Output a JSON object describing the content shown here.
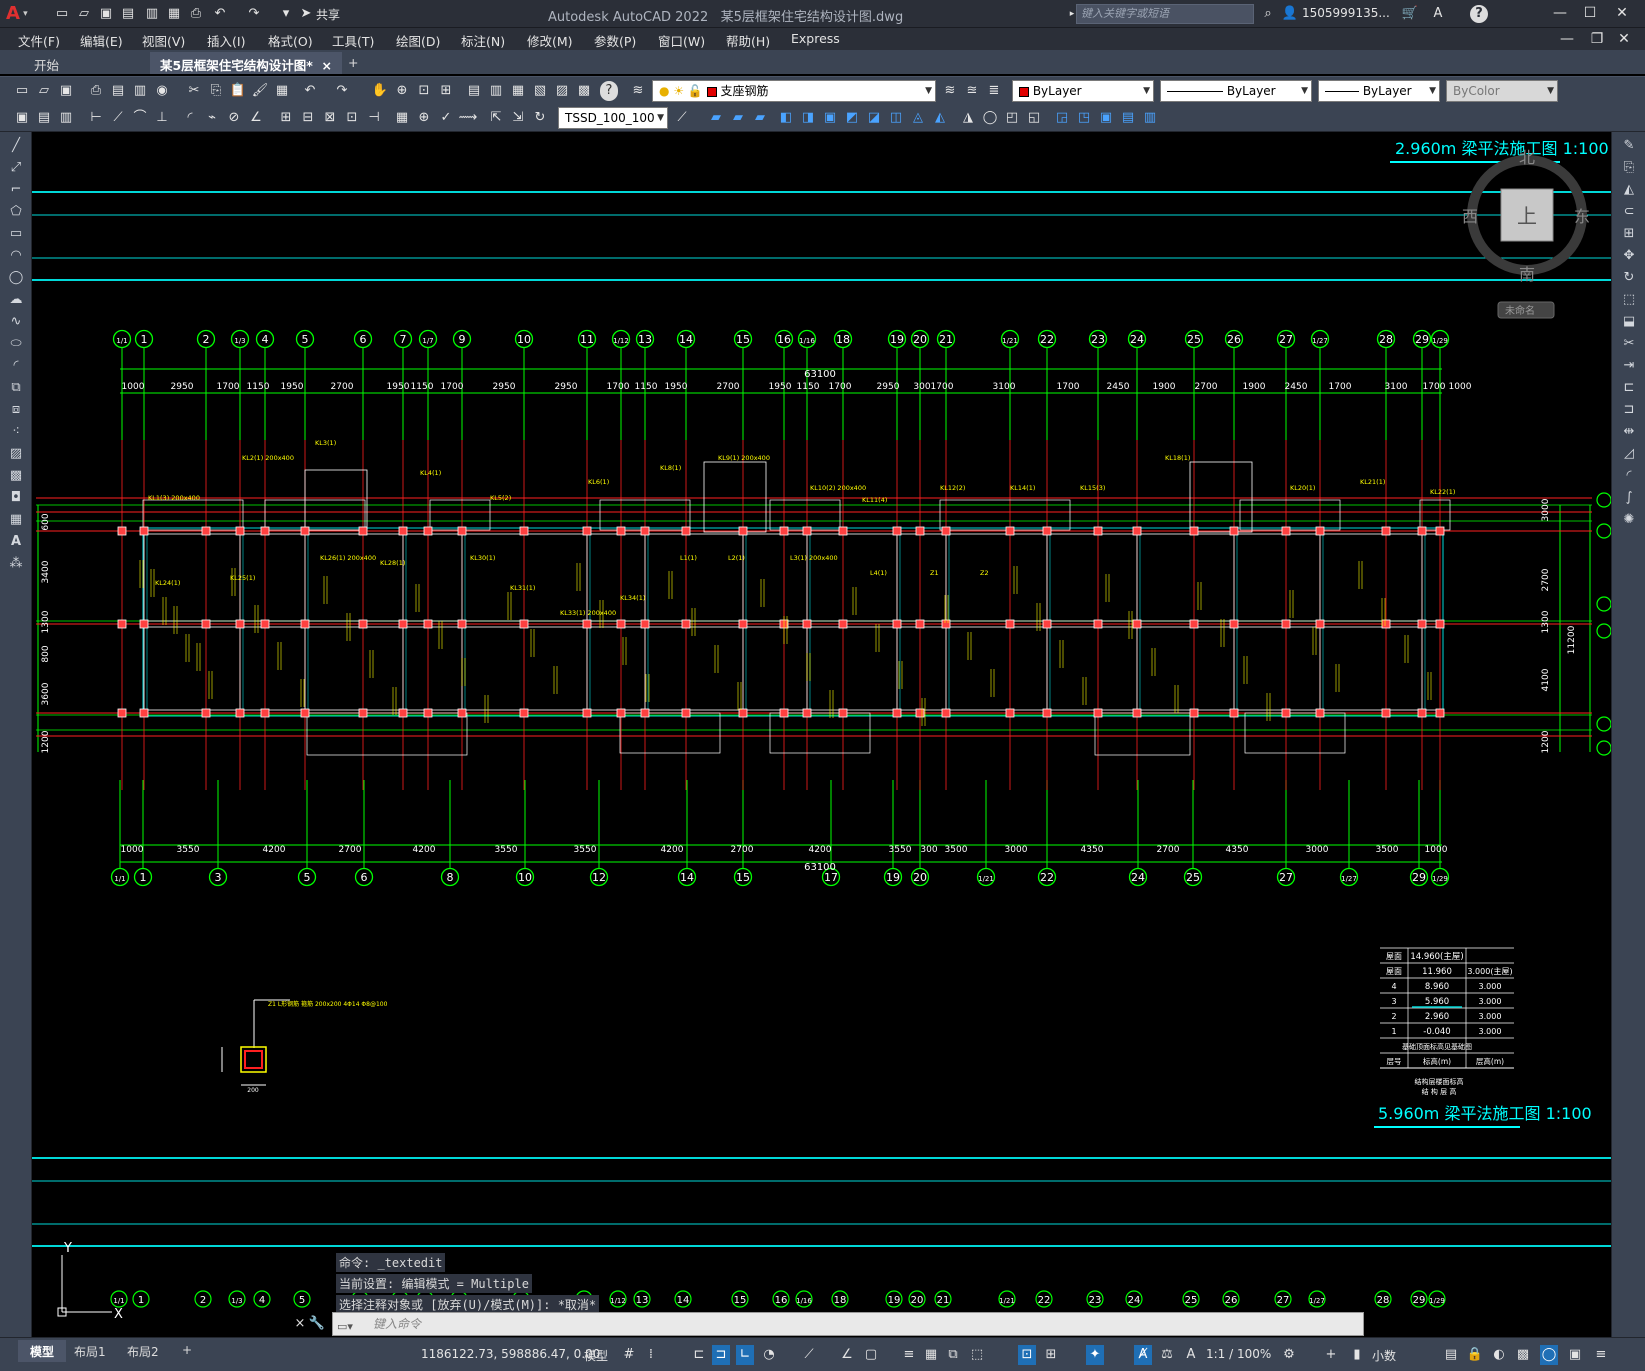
{
  "app": {
    "logo": "A",
    "title": "Autodesk AutoCAD 2022",
    "filename": "某5层框架住宅结构设计图.dwg",
    "share_label": "共享",
    "search_placeholder": "键入关键字或短语",
    "user": "1505999135...",
    "help": "?"
  },
  "menu": [
    "文件(F)",
    "编辑(E)",
    "视图(V)",
    "插入(I)",
    "格式(O)",
    "工具(T)",
    "绘图(D)",
    "标注(N)",
    "修改(M)",
    "参数(P)",
    "窗口(W)",
    "帮助(H)",
    "Express"
  ],
  "tabs": {
    "start": "开始",
    "doc": "某5层框架住宅结构设计图*",
    "close": "×",
    "add": "+"
  },
  "toolbar": {
    "layer": "支座钢筋",
    "color": "ByLayer",
    "linetype": "ByLayer",
    "lineweight": "ByLayer",
    "plotstyle": "ByColor",
    "textstyle": "TSSD_100_100"
  },
  "drawing": {
    "title_top": "2.960m 梁平法施工图 1:100",
    "title_bottom": "5.960m 梁平法施工图 1:100",
    "overall_dim": "63100",
    "viewcube": {
      "north": "北",
      "south": "南",
      "east": "东",
      "west": "西",
      "top": "上",
      "wcs": "未命名"
    },
    "top_axes": [
      "1/1",
      "1",
      "2",
      "1/3",
      "4",
      "5",
      "6",
      "7",
      "1/7",
      "9",
      "10",
      "11",
      "1/12",
      "13",
      "14",
      "15",
      "16",
      "1/16",
      "18",
      "19",
      "20",
      "21",
      "1/21",
      "22",
      "23",
      "24",
      "25",
      "26",
      "27",
      "1/27",
      "28",
      "29",
      "1/29"
    ],
    "bottom_axes": [
      "1/1",
      "1",
      "3",
      "5",
      "6",
      "8",
      "10",
      "12",
      "14",
      "15",
      "17",
      "19",
      "20",
      "1/21",
      "22",
      "24",
      "25",
      "27",
      "1/27",
      "29",
      "1/29"
    ],
    "top_dims": [
      "1000",
      "2950",
      "1700",
      "1150",
      "1950",
      "2700",
      "1950",
      "1150",
      "1700",
      "2950",
      "2950",
      "1700",
      "1150",
      "1950",
      "2700",
      "1950",
      "1150",
      "1700",
      "2950",
      "300",
      "1700",
      "3100",
      "1700",
      "2450",
      "1900",
      "2700",
      "1900",
      "2450",
      "1700",
      "3100",
      "1700",
      "1000"
    ],
    "bottom_dims": [
      "1000",
      "3550",
      "4200",
      "2700",
      "4200",
      "3550",
      "3550",
      "4200",
      "2700",
      "4200",
      "3550",
      "300",
      "3500",
      "3000",
      "4350",
      "2700",
      "4350",
      "3000",
      "3500",
      "1000"
    ],
    "left_dims": [
      "600",
      "3400",
      "1300",
      "800",
      "3600",
      "1200"
    ],
    "right_dims": [
      "3000",
      "2700",
      "1300",
      "4100",
      "1200",
      "11200"
    ],
    "beam_labels": [
      "KL1(3) 200x400",
      "KL2(1) 200x400",
      "KL3(1)",
      "KL4(1)",
      "KL5(2)",
      "KL6(1)",
      "KL8(1)",
      "KL9(1) 200x400",
      "KL10(2) 200x400",
      "KL11(4)",
      "KL12(2)",
      "KL14(1)",
      "KL15(3)",
      "KL18(1)",
      "KL20(1)",
      "KL21(1)",
      "KL22(1)",
      "KL24(1)",
      "KL25(1)",
      "KL26(1) 200x400",
      "KL28(1)",
      "KL30(1)",
      "KL31(1)",
      "KL33(1) 200x400",
      "KL34(1)",
      "L1(1)",
      "L2(1)",
      "L3(1) 200x400",
      "L4(1)",
      "Z1",
      "Z2"
    ],
    "table_rows": [
      {
        "floor": "屋面",
        "elev": "14.960(主屋)",
        "height": ""
      },
      {
        "floor": "屋面",
        "elev": "11.960",
        "height": "3.000(主屋)"
      },
      {
        "floor": "4",
        "elev": "8.960",
        "height": "3.000"
      },
      {
        "floor": "3",
        "elev": "5.960",
        "height": "3.000"
      },
      {
        "floor": "2",
        "elev": "2.960",
        "height": "3.000"
      },
      {
        "floor": "1",
        "elev": "-0.040",
        "height": "3.000"
      }
    ],
    "table_note": "基础顶面标高见基础图",
    "table_header": {
      "floor": "层号",
      "elev": "标高(m)",
      "height": "层高(m)"
    },
    "table_caption": "结构层楼面标高\n结 构 层 高",
    "detail_label": "Z1 L形钢筋 箍筋 200x200 4Φ14 Φ8@100",
    "detail_dim": "200"
  },
  "command": {
    "history": [
      "命令: _textedit",
      "当前设置: 编辑模式 = Multiple",
      "选择注释对象或 [放弃(U)/模式(M)]: *取消*"
    ],
    "placeholder": "键入命令",
    "close": "×"
  },
  "layouts": [
    "模型",
    "布局1",
    "布局2"
  ],
  "layout_add": "+",
  "status": {
    "coords": "1186122.73, 598886.47, 0.00",
    "mode": "模型",
    "scale": "1:1 / 100%",
    "units": "小数"
  },
  "colors": {
    "green": "#00ff00",
    "cyan": "#00d8d8",
    "red": "#ff2020",
    "yellow": "#ffff00",
    "white": "#ffffff",
    "accent": "#1f6fb5"
  }
}
